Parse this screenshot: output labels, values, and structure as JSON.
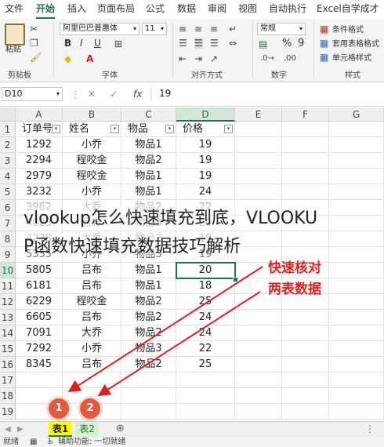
{
  "menu": [
    "文件",
    "开始",
    "插入",
    "页面布局",
    "公式",
    "数据",
    "审阅",
    "视图",
    "自动执行",
    "Excel自学成才"
  ],
  "ribbon": {
    "paste_label": "粘贴",
    "font_name": "阿里巴巴普惠体",
    "font_size": "11",
    "number_format": "常规",
    "conditional_format": "条件格式",
    "table_format": "套用表格格式",
    "cell_style": "单元格样式",
    "bold": "B",
    "italic": "I",
    "underline": "U",
    "percent": "%",
    "comma": "9",
    "groups": [
      "剪贴板",
      "字体",
      "对齐方式",
      "数字",
      "样式"
    ]
  },
  "formula_bar": {
    "name_box": "D10",
    "fx": "fx",
    "value": "19"
  },
  "columns": [
    "A",
    "B",
    "C",
    "D",
    "E",
    "F",
    "G"
  ],
  "rows": [
    "1",
    "2",
    "3",
    "4",
    "5",
    "6",
    "7",
    "8",
    "9",
    "10",
    "11",
    "12",
    "13",
    "14",
    "15",
    "16",
    "17",
    "18",
    "19"
  ],
  "header_cells": [
    "订单号",
    "姓名",
    "物品",
    "价格"
  ],
  "table_rows": [
    [
      "1292",
      "小乔",
      "物品1",
      "19"
    ],
    [
      "2294",
      "程咬金",
      "物品2",
      "19"
    ],
    [
      "2979",
      "程咬金",
      "物品1",
      "19"
    ],
    [
      "3232",
      "小乔",
      "物品1",
      "24"
    ],
    [
      "3962",
      "大乔",
      "物品2",
      "22"
    ],
    [
      "4023",
      "吕布",
      "物品3",
      "20"
    ],
    [
      "4278",
      "大乔",
      "物品2",
      "19"
    ],
    [
      "5355",
      "小乔",
      "物品3",
      "19"
    ],
    [
      "5805",
      "吕布",
      "物品1",
      "20"
    ],
    [
      "6181",
      "吕布",
      "物品1",
      "18"
    ],
    [
      "6229",
      "程咬金",
      "物品2",
      "25"
    ],
    [
      "6605",
      "吕布",
      "物品2",
      "24"
    ],
    [
      "7091",
      "大乔",
      "物品2",
      "24"
    ],
    [
      "7292",
      "小乔",
      "物品3",
      "22"
    ],
    [
      "8345",
      "吕布",
      "物品2",
      "25"
    ]
  ],
  "overlay_title_line1": "vlookup怎么快速填充到底，VLOOKU",
  "overlay_title_line2": "P函数快速填充数据技巧解析",
  "callout_line1": "快速核对",
  "callout_line2": "两表数据",
  "badges": [
    "1",
    "2"
  ],
  "sheet_tabs": [
    "表1",
    "表2"
  ],
  "add_sheet": "⊕",
  "status": {
    "ready": "就绪",
    "accessibility": "辅助功能: 一切就绪"
  },
  "colors": {
    "excel_green": "#217346",
    "tab1_bg": "#ffff00",
    "tab2_bg": "#d9f0d0",
    "callout_red": "#e01e1e",
    "badge": "#e25b3c"
  }
}
